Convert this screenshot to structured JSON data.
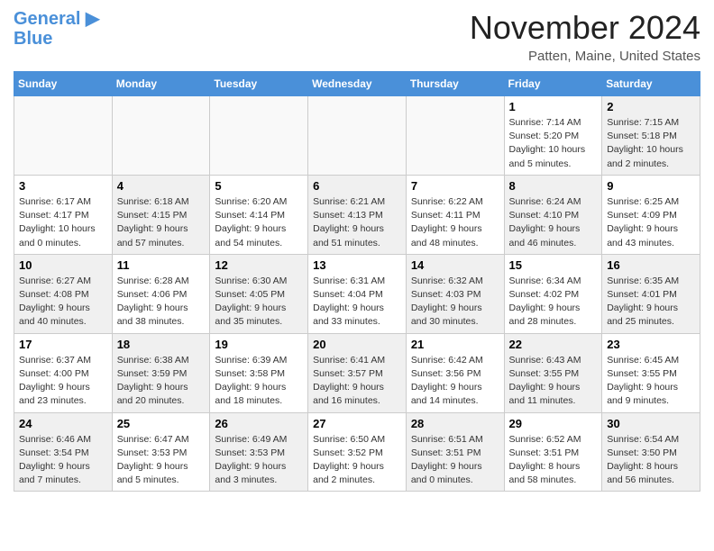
{
  "logo": {
    "line1": "General",
    "line2": "Blue",
    "bird_symbol": "▶"
  },
  "title": "November 2024",
  "subtitle": "Patten, Maine, United States",
  "weekdays": [
    "Sunday",
    "Monday",
    "Tuesday",
    "Wednesday",
    "Thursday",
    "Friday",
    "Saturday"
  ],
  "weeks": [
    [
      {
        "day": "",
        "info": "",
        "empty": true
      },
      {
        "day": "",
        "info": "",
        "empty": true
      },
      {
        "day": "",
        "info": "",
        "empty": true
      },
      {
        "day": "",
        "info": "",
        "empty": true
      },
      {
        "day": "",
        "info": "",
        "empty": true
      },
      {
        "day": "1",
        "info": "Sunrise: 7:14 AM\nSunset: 5:20 PM\nDaylight: 10 hours\nand 5 minutes.",
        "empty": false,
        "shaded": false
      },
      {
        "day": "2",
        "info": "Sunrise: 7:15 AM\nSunset: 5:18 PM\nDaylight: 10 hours\nand 2 minutes.",
        "empty": false,
        "shaded": true
      }
    ],
    [
      {
        "day": "3",
        "info": "Sunrise: 6:17 AM\nSunset: 4:17 PM\nDaylight: 10 hours\nand 0 minutes.",
        "empty": false,
        "shaded": false
      },
      {
        "day": "4",
        "info": "Sunrise: 6:18 AM\nSunset: 4:15 PM\nDaylight: 9 hours\nand 57 minutes.",
        "empty": false,
        "shaded": true
      },
      {
        "day": "5",
        "info": "Sunrise: 6:20 AM\nSunset: 4:14 PM\nDaylight: 9 hours\nand 54 minutes.",
        "empty": false,
        "shaded": false
      },
      {
        "day": "6",
        "info": "Sunrise: 6:21 AM\nSunset: 4:13 PM\nDaylight: 9 hours\nand 51 minutes.",
        "empty": false,
        "shaded": true
      },
      {
        "day": "7",
        "info": "Sunrise: 6:22 AM\nSunset: 4:11 PM\nDaylight: 9 hours\nand 48 minutes.",
        "empty": false,
        "shaded": false
      },
      {
        "day": "8",
        "info": "Sunrise: 6:24 AM\nSunset: 4:10 PM\nDaylight: 9 hours\nand 46 minutes.",
        "empty": false,
        "shaded": true
      },
      {
        "day": "9",
        "info": "Sunrise: 6:25 AM\nSunset: 4:09 PM\nDaylight: 9 hours\nand 43 minutes.",
        "empty": false,
        "shaded": false
      }
    ],
    [
      {
        "day": "10",
        "info": "Sunrise: 6:27 AM\nSunset: 4:08 PM\nDaylight: 9 hours\nand 40 minutes.",
        "empty": false,
        "shaded": true
      },
      {
        "day": "11",
        "info": "Sunrise: 6:28 AM\nSunset: 4:06 PM\nDaylight: 9 hours\nand 38 minutes.",
        "empty": false,
        "shaded": false
      },
      {
        "day": "12",
        "info": "Sunrise: 6:30 AM\nSunset: 4:05 PM\nDaylight: 9 hours\nand 35 minutes.",
        "empty": false,
        "shaded": true
      },
      {
        "day": "13",
        "info": "Sunrise: 6:31 AM\nSunset: 4:04 PM\nDaylight: 9 hours\nand 33 minutes.",
        "empty": false,
        "shaded": false
      },
      {
        "day": "14",
        "info": "Sunrise: 6:32 AM\nSunset: 4:03 PM\nDaylight: 9 hours\nand 30 minutes.",
        "empty": false,
        "shaded": true
      },
      {
        "day": "15",
        "info": "Sunrise: 6:34 AM\nSunset: 4:02 PM\nDaylight: 9 hours\nand 28 minutes.",
        "empty": false,
        "shaded": false
      },
      {
        "day": "16",
        "info": "Sunrise: 6:35 AM\nSunset: 4:01 PM\nDaylight: 9 hours\nand 25 minutes.",
        "empty": false,
        "shaded": true
      }
    ],
    [
      {
        "day": "17",
        "info": "Sunrise: 6:37 AM\nSunset: 4:00 PM\nDaylight: 9 hours\nand 23 minutes.",
        "empty": false,
        "shaded": false
      },
      {
        "day": "18",
        "info": "Sunrise: 6:38 AM\nSunset: 3:59 PM\nDaylight: 9 hours\nand 20 minutes.",
        "empty": false,
        "shaded": true
      },
      {
        "day": "19",
        "info": "Sunrise: 6:39 AM\nSunset: 3:58 PM\nDaylight: 9 hours\nand 18 minutes.",
        "empty": false,
        "shaded": false
      },
      {
        "day": "20",
        "info": "Sunrise: 6:41 AM\nSunset: 3:57 PM\nDaylight: 9 hours\nand 16 minutes.",
        "empty": false,
        "shaded": true
      },
      {
        "day": "21",
        "info": "Sunrise: 6:42 AM\nSunset: 3:56 PM\nDaylight: 9 hours\nand 14 minutes.",
        "empty": false,
        "shaded": false
      },
      {
        "day": "22",
        "info": "Sunrise: 6:43 AM\nSunset: 3:55 PM\nDaylight: 9 hours\nand 11 minutes.",
        "empty": false,
        "shaded": true
      },
      {
        "day": "23",
        "info": "Sunrise: 6:45 AM\nSunset: 3:55 PM\nDaylight: 9 hours\nand 9 minutes.",
        "empty": false,
        "shaded": false
      }
    ],
    [
      {
        "day": "24",
        "info": "Sunrise: 6:46 AM\nSunset: 3:54 PM\nDaylight: 9 hours\nand 7 minutes.",
        "empty": false,
        "shaded": true
      },
      {
        "day": "25",
        "info": "Sunrise: 6:47 AM\nSunset: 3:53 PM\nDaylight: 9 hours\nand 5 minutes.",
        "empty": false,
        "shaded": false
      },
      {
        "day": "26",
        "info": "Sunrise: 6:49 AM\nSunset: 3:53 PM\nDaylight: 9 hours\nand 3 minutes.",
        "empty": false,
        "shaded": true
      },
      {
        "day": "27",
        "info": "Sunrise: 6:50 AM\nSunset: 3:52 PM\nDaylight: 9 hours\nand 2 minutes.",
        "empty": false,
        "shaded": false
      },
      {
        "day": "28",
        "info": "Sunrise: 6:51 AM\nSunset: 3:51 PM\nDaylight: 9 hours\nand 0 minutes.",
        "empty": false,
        "shaded": true
      },
      {
        "day": "29",
        "info": "Sunrise: 6:52 AM\nSunset: 3:51 PM\nDaylight: 8 hours\nand 58 minutes.",
        "empty": false,
        "shaded": false
      },
      {
        "day": "30",
        "info": "Sunrise: 6:54 AM\nSunset: 3:50 PM\nDaylight: 8 hours\nand 56 minutes.",
        "empty": false,
        "shaded": true
      }
    ]
  ]
}
